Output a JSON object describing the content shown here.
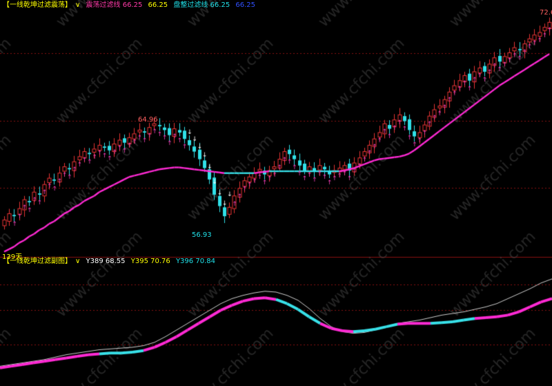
{
  "main_panel": {
    "indicator_name": "【一线乾坤过滤震荡】",
    "dropdown_glyph": "∨",
    "values": [
      {
        "label": "震荡过滤线",
        "value": "66.25",
        "color": "#ff3aa8"
      },
      {
        "label": "",
        "value": "66.25",
        "color": "#ffff00"
      },
      {
        "label": "盘整过滤线",
        "value": "66.25",
        "color": "#20e0e8"
      },
      {
        "label": "",
        "value": "66.25",
        "color": "#3050ff"
      }
    ],
    "annotations": {
      "high": "64.96",
      "low": "56.93",
      "right": "72.6",
      "days": "139天"
    }
  },
  "sub_panel": {
    "indicator_name": "【一线乾坤过滤副图】",
    "dropdown_glyph": "∨",
    "values": [
      {
        "label": "Y389",
        "value": "68.55",
        "color": "#ffffff"
      },
      {
        "label": "Y395",
        "value": "70.76",
        "color": "#ffff00"
      },
      {
        "label": "Y396",
        "value": "70.84",
        "color": "#20e0e8"
      }
    ]
  },
  "colors": {
    "up": "#e83535",
    "down": "#30e0e8",
    "line_magenta": "#ff2ad4",
    "line_cyan": "#38e0e8",
    "arrow_up": "#ff40c0",
    "arrow_down": "#ffffff",
    "grid": "#8a1010",
    "watermark": "#555555"
  },
  "watermark_text": "www.cfchi.com",
  "chart_data": [
    {
      "type": "candlestick",
      "closes": [
        57.0,
        57.5,
        57.3,
        57.9,
        58.6,
        58.4,
        59.2,
        59.0,
        59.8,
        60.3,
        60.1,
        60.7,
        61.2,
        61.0,
        61.6,
        62.0,
        62.4,
        62.2,
        62.6,
        62.9,
        62.7,
        62.5,
        63.0,
        63.3,
        63.1,
        63.5,
        63.8,
        64.1,
        63.9,
        64.3,
        64.6,
        64.4,
        64.1,
        63.7,
        64.2,
        63.9,
        63.4,
        62.9,
        62.4,
        61.8,
        61.1,
        60.2,
        59.0,
        58.1,
        57.3,
        58.0,
        58.9,
        59.5,
        60.1,
        60.4,
        60.7,
        61.0,
        60.6,
        60.9,
        61.2,
        61.8,
        62.4,
        62.2,
        61.8,
        61.3,
        60.9,
        61.2,
        60.8,
        61.3,
        61.0,
        60.6,
        60.9,
        61.1,
        61.3,
        60.9,
        61.5,
        61.9,
        62.4,
        62.9,
        63.4,
        63.9,
        64.6,
        64.2,
        64.9,
        65.3,
        64.8,
        64.1,
        63.6,
        63.9,
        64.5,
        65.2,
        65.7,
        66.0,
        66.5,
        67.1,
        67.6,
        68.0,
        68.4,
        68.0,
        68.7,
        69.0,
        68.7,
        69.3,
        69.8,
        69.5,
        69.9,
        70.2,
        70.6,
        70.4,
        70.9,
        71.3,
        71.6,
        71.8,
        72.2,
        72.6
      ],
      "magenta_line": [
        54.5,
        54.7,
        54.9,
        55.2,
        55.4,
        55.7,
        55.9,
        56.2,
        56.4,
        56.7,
        56.9,
        57.2,
        57.5,
        57.7,
        58.0,
        58.2,
        58.5,
        58.7,
        58.9,
        59.2,
        59.4,
        59.6,
        59.8,
        60.0,
        60.2,
        60.4,
        60.5,
        60.6,
        60.7,
        60.8,
        60.9,
        61.0,
        61.05,
        61.1,
        61.15,
        61.15,
        61.1,
        61.05,
        61.0,
        60.95,
        60.9,
        60.85,
        60.8,
        60.75,
        60.7,
        60.7,
        60.7,
        60.7,
        60.7,
        60.7,
        60.7,
        60.75,
        60.8,
        60.85,
        60.85,
        60.85,
        60.85,
        60.85,
        60.85,
        60.85,
        60.85,
        60.85,
        60.85,
        60.85,
        60.85,
        60.85,
        60.85,
        60.85,
        60.9,
        61.0,
        61.1,
        61.25,
        61.4,
        61.55,
        61.7,
        61.8,
        61.85,
        61.9,
        61.95,
        62.0,
        62.1,
        62.25,
        62.5,
        62.8,
        63.1,
        63.4,
        63.7,
        64.0,
        64.3,
        64.6,
        64.9,
        65.2,
        65.5,
        65.8,
        66.1,
        66.4,
        66.7,
        67.0,
        67.3,
        67.6,
        67.85,
        68.1,
        68.35,
        68.6,
        68.85,
        69.1,
        69.35,
        69.6,
        69.85,
        70.1
      ],
      "ylim": [
        54.2,
        73.6
      ],
      "high_label": 64.96,
      "low_label": 56.93,
      "last_label": 72.6
    },
    {
      "type": "line",
      "white_series": [
        0.04,
        0.06,
        0.08,
        0.1,
        0.12,
        0.15,
        0.18,
        0.2,
        0.22,
        0.24,
        0.25,
        0.26,
        0.27,
        0.29,
        0.33,
        0.4,
        0.48,
        0.56,
        0.64,
        0.72,
        0.8,
        0.86,
        0.9,
        0.93,
        0.95,
        0.94,
        0.9,
        0.84,
        0.74,
        0.62,
        0.52,
        0.46,
        0.44,
        0.45,
        0.48,
        0.52,
        0.56,
        0.58,
        0.6,
        0.63,
        0.66,
        0.68,
        0.7,
        0.73,
        0.76,
        0.8,
        0.86,
        0.92,
        0.98,
        1.05,
        1.1
      ],
      "colored_series": [
        0.02,
        0.04,
        0.06,
        0.08,
        0.1,
        0.12,
        0.14,
        0.16,
        0.18,
        0.19,
        0.2,
        0.2,
        0.21,
        0.23,
        0.27,
        0.33,
        0.4,
        0.48,
        0.56,
        0.64,
        0.72,
        0.78,
        0.83,
        0.86,
        0.87,
        0.85,
        0.8,
        0.73,
        0.64,
        0.56,
        0.5,
        0.47,
        0.46,
        0.47,
        0.49,
        0.52,
        0.55,
        0.56,
        0.56,
        0.56,
        0.57,
        0.58,
        0.6,
        0.62,
        0.63,
        0.64,
        0.66,
        0.7,
        0.76,
        0.82,
        0.86
      ],
      "ylim": [
        -0.2,
        1.25
      ]
    }
  ]
}
